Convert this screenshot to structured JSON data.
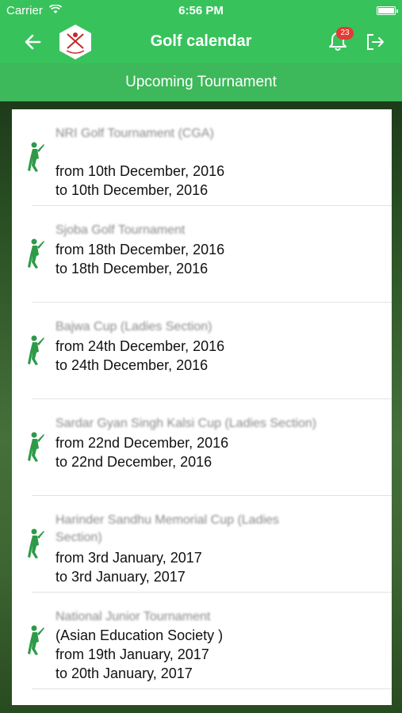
{
  "status": {
    "carrier": "Carrier",
    "time": "6:56 PM"
  },
  "nav": {
    "title": "Golf calendar",
    "badge": "23",
    "back_icon": "back-arrow-icon",
    "bell_icon": "bell-icon",
    "logout_icon": "logout-icon"
  },
  "subheader": "Upcoming Tournament",
  "colors": {
    "green": "#38c25c",
    "badge": "#e53935"
  },
  "tournaments": [
    {
      "name": "NRI Golf Tournament (CGA)",
      "from": "from 10th December, 2016",
      "to": "to 10th December, 2016"
    },
    {
      "name": "Sjoba Golf Tournament",
      "from": "from 18th December, 2016",
      "to": "to 18th December, 2016"
    },
    {
      "name": "Bajwa Cup (Ladies Section)",
      "from": "from 24th December, 2016",
      "to": "to 24th December, 2016"
    },
    {
      "name": "Sardar Gyan Singh Kalsi Cup (Ladies Section)",
      "from": "from 22nd December, 2016",
      "to": "to 22nd December, 2016"
    },
    {
      "name": "Harinder Sandhu Memorial Cup (Ladies",
      "name2": "Section)",
      "from": "from 3rd January, 2017",
      "to": "to 3rd January, 2017"
    },
    {
      "name": "National Junior Tournament",
      "venue": "(Asian Education Society )",
      "from": "from 19th January, 2017",
      "to": "to 20th January, 2017"
    }
  ]
}
